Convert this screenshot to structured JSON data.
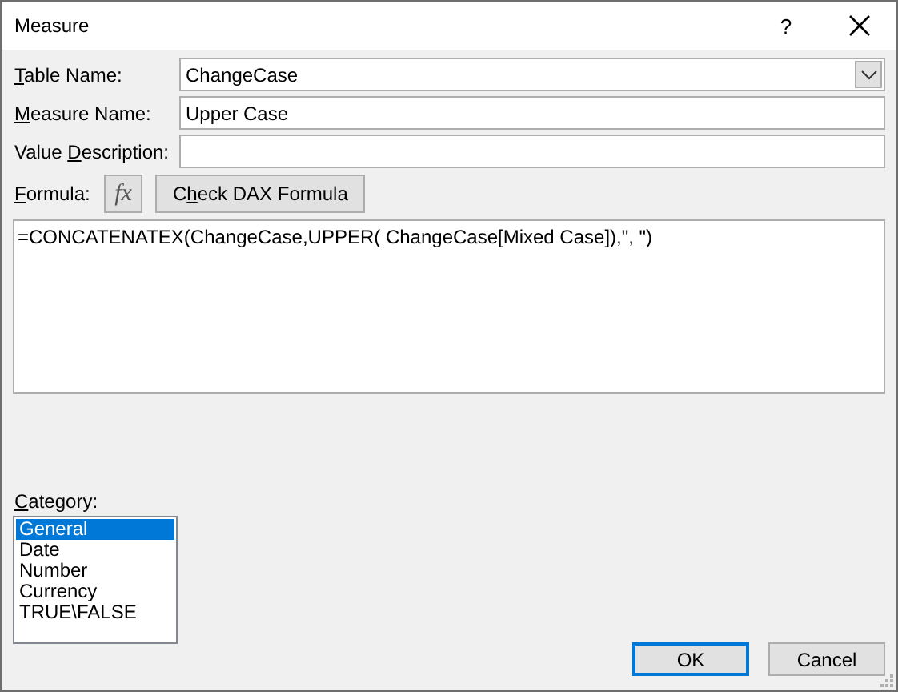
{
  "window": {
    "title": "Measure",
    "help": "?"
  },
  "fields": [
    {
      "kind": "dropdown",
      "label": [
        {
          "text": "T",
          "underline": true
        },
        {
          "text": "able Name:",
          "underline": false
        }
      ],
      "value": "ChangeCase"
    },
    {
      "kind": "text",
      "label": [
        {
          "text": "M",
          "underline": true
        },
        {
          "text": "easure Name:",
          "underline": false
        }
      ],
      "value": "Upper Case"
    },
    {
      "kind": "text",
      "label": [
        {
          "text": "Value ",
          "underline": false
        },
        {
          "text": "D",
          "underline": true
        },
        {
          "text": "escription:",
          "underline": false
        }
      ]
    }
  ],
  "formula": {
    "label": [
      {
        "text": "F",
        "underline": true
      },
      {
        "text": "ormula:",
        "underline": false
      }
    ],
    "fx": "fx",
    "check_button": [
      {
        "text": "C",
        "underline": false
      },
      {
        "text": "h",
        "underline": true
      },
      {
        "text": "eck DAX Formula",
        "underline": false
      }
    ],
    "value": "=CONCATENATEX(ChangeCase,UPPER( ChangeCase[Mixed Case]),\", \")"
  },
  "category": {
    "label": [
      {
        "text": "C",
        "underline": true
      },
      {
        "text": "ategory:",
        "underline": false
      }
    ],
    "items": [
      {
        "label": "General",
        "selected": true
      },
      {
        "label": "Date",
        "selected": false
      },
      {
        "label": "Number",
        "selected": false
      },
      {
        "label": "Currency",
        "selected": false
      },
      {
        "label": "TRUE\\FALSE",
        "selected": false
      }
    ]
  },
  "buttons": [
    {
      "label": "OK",
      "default": true
    },
    {
      "label": "Cancel",
      "default": false
    }
  ]
}
